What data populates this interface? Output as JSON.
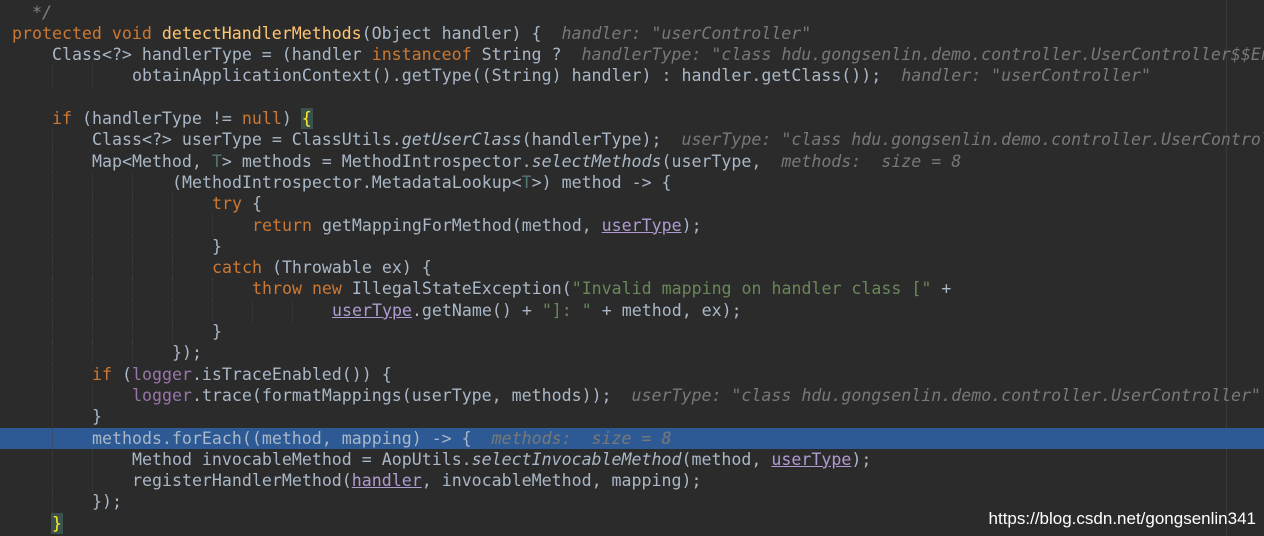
{
  "editor": {
    "lines": [
      {
        "indent": 0,
        "current": false,
        "tokens": [
          {
            "t": "  */",
            "c": "cm"
          }
        ]
      },
      {
        "indent": 0,
        "current": false,
        "tokens": [
          {
            "t": "protected void ",
            "c": "kw"
          },
          {
            "t": "detectHandlerMethods",
            "c": "fn"
          },
          {
            "t": "(Object handler) {  ",
            "c": ""
          },
          {
            "t": "handler: \"userController\"",
            "c": "hint"
          }
        ]
      },
      {
        "indent": 1,
        "current": false,
        "tokens": [
          {
            "t": "Class<?> handlerType = (handler ",
            "c": ""
          },
          {
            "t": "instanceof ",
            "c": "kw"
          },
          {
            "t": "String ?  ",
            "c": ""
          },
          {
            "t": "handlerType: \"class hdu.gongsenlin.demo.controller.UserController$$En",
            "c": "hint"
          }
        ]
      },
      {
        "indent": 3,
        "current": false,
        "tokens": [
          {
            "t": "obtainApplicationContext().getType((String) handler) : handler.getClass());  ",
            "c": ""
          },
          {
            "t": "handler: \"userController\"",
            "c": "hint"
          }
        ]
      },
      {
        "indent": 0,
        "current": false,
        "tokens": []
      },
      {
        "indent": 1,
        "current": false,
        "tokens": [
          {
            "t": "if ",
            "c": "kw"
          },
          {
            "t": "(handlerType != ",
            "c": ""
          },
          {
            "t": "null",
            "c": "kw"
          },
          {
            "t": ") ",
            "c": ""
          },
          {
            "t": "{",
            "c": "brace-hl"
          }
        ]
      },
      {
        "indent": 2,
        "current": false,
        "tokens": [
          {
            "t": "Class<?> userType = ClassUtils.",
            "c": ""
          },
          {
            "t": "getUserClass",
            "c": "it"
          },
          {
            "t": "(handlerType);  ",
            "c": ""
          },
          {
            "t": "userType: \"class hdu.gongsenlin.demo.controller.UserControl",
            "c": "hint"
          }
        ]
      },
      {
        "indent": 2,
        "current": false,
        "tokens": [
          {
            "t": "Map<Method, ",
            "c": ""
          },
          {
            "t": "T",
            "c": "tp"
          },
          {
            "t": "> methods = MethodIntrospector.",
            "c": ""
          },
          {
            "t": "selectMethods",
            "c": "it"
          },
          {
            "t": "(userType,  ",
            "c": ""
          },
          {
            "t": "methods:  size = 8",
            "c": "hint"
          }
        ]
      },
      {
        "indent": 4,
        "current": false,
        "tokens": [
          {
            "t": "(MethodIntrospector.MetadataLookup<",
            "c": ""
          },
          {
            "t": "T",
            "c": "tp"
          },
          {
            "t": ">) method -> {",
            "c": ""
          }
        ]
      },
      {
        "indent": 5,
        "current": false,
        "tokens": [
          {
            "t": "try ",
            "c": "kw"
          },
          {
            "t": "{",
            "c": ""
          }
        ]
      },
      {
        "indent": 6,
        "current": false,
        "tokens": [
          {
            "t": "return ",
            "c": "kw"
          },
          {
            "t": "getMappingForMethod(method, ",
            "c": ""
          },
          {
            "t": "userType",
            "c": "ul"
          },
          {
            "t": ");",
            "c": ""
          }
        ]
      },
      {
        "indent": 5,
        "current": false,
        "tokens": [
          {
            "t": "}",
            "c": ""
          }
        ]
      },
      {
        "indent": 5,
        "current": false,
        "tokens": [
          {
            "t": "catch ",
            "c": "kw"
          },
          {
            "t": "(Throwable ex) {",
            "c": ""
          }
        ]
      },
      {
        "indent": 6,
        "current": false,
        "tokens": [
          {
            "t": "throw new ",
            "c": "kw"
          },
          {
            "t": "IllegalStateException(",
            "c": ""
          },
          {
            "t": "\"Invalid mapping on handler class [\" ",
            "c": "st"
          },
          {
            "t": "+",
            "c": ""
          }
        ]
      },
      {
        "indent": 8,
        "current": false,
        "tokens": [
          {
            "t": "userType",
            "c": "ul"
          },
          {
            "t": ".getName() + ",
            "c": ""
          },
          {
            "t": "\"]: \" ",
            "c": "st"
          },
          {
            "t": "+ method, ex);",
            "c": ""
          }
        ]
      },
      {
        "indent": 5,
        "current": false,
        "tokens": [
          {
            "t": "}",
            "c": ""
          }
        ]
      },
      {
        "indent": 4,
        "current": false,
        "tokens": [
          {
            "t": "});",
            "c": ""
          }
        ]
      },
      {
        "indent": 2,
        "current": false,
        "tokens": [
          {
            "t": "if ",
            "c": "kw"
          },
          {
            "t": "(",
            "c": ""
          },
          {
            "t": "logger",
            "c": "field"
          },
          {
            "t": ".isTraceEnabled()) {",
            "c": ""
          }
        ]
      },
      {
        "indent": 3,
        "current": false,
        "tokens": [
          {
            "t": "logger",
            "c": "field"
          },
          {
            "t": ".trace(formatMappings(userType, methods));  ",
            "c": ""
          },
          {
            "t": "userType: \"class hdu.gongsenlin.demo.controller.UserController\"",
            "c": "hint"
          }
        ]
      },
      {
        "indent": 2,
        "current": false,
        "tokens": [
          {
            "t": "}",
            "c": ""
          }
        ]
      },
      {
        "indent": 2,
        "current": true,
        "tokens": [
          {
            "t": "methods.forEach((method, mapping) -> {  ",
            "c": ""
          },
          {
            "t": "methods:  size = 8",
            "c": "hint"
          }
        ]
      },
      {
        "indent": 3,
        "current": false,
        "tokens": [
          {
            "t": "Method invocableMethod = AopUtils.",
            "c": ""
          },
          {
            "t": "selectInvocableMethod",
            "c": "it"
          },
          {
            "t": "(method, ",
            "c": ""
          },
          {
            "t": "userType",
            "c": "ul"
          },
          {
            "t": ");",
            "c": ""
          }
        ]
      },
      {
        "indent": 3,
        "current": false,
        "tokens": [
          {
            "t": "registerHandlerMethod(",
            "c": ""
          },
          {
            "t": "handler",
            "c": "ul"
          },
          {
            "t": ", invocableMethod, mapping);",
            "c": ""
          }
        ]
      },
      {
        "indent": 2,
        "current": false,
        "tokens": [
          {
            "t": "});",
            "c": ""
          }
        ]
      },
      {
        "indent": 1,
        "current": false,
        "tokens": [
          {
            "t": "}",
            "c": "brace-hl"
          }
        ]
      },
      {
        "indent": 0,
        "current": false,
        "tokens": [
          {
            "t": "}",
            "c": ""
          }
        ]
      }
    ]
  },
  "watermark": "https://blog.csdn.net/gongsenlin341"
}
